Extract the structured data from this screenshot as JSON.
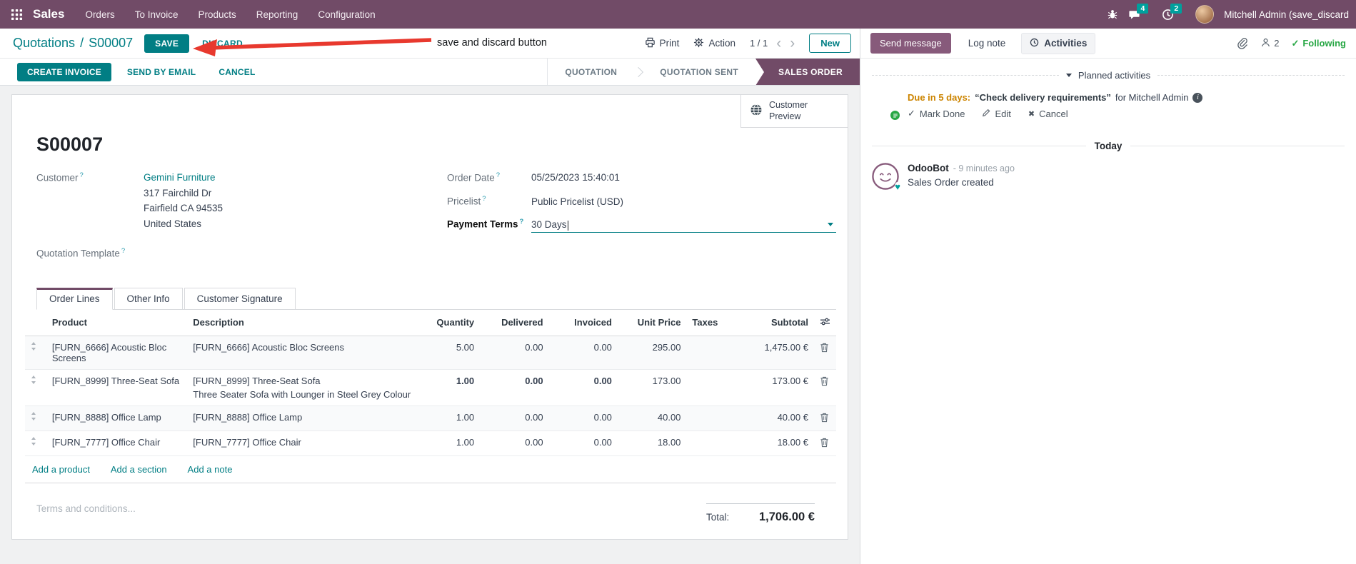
{
  "nav": {
    "app_name": "Sales",
    "menus": [
      "Orders",
      "To Invoice",
      "Products",
      "Reporting",
      "Configuration"
    ],
    "messages_badge": "4",
    "activities_badge": "2",
    "user_name": "Mitchell Admin (save_discard"
  },
  "breadcrumb": {
    "parent": "Quotations",
    "separator": "/",
    "current": "S00007"
  },
  "edit_actions": {
    "save": "SAVE",
    "discard": "DISCARD"
  },
  "annotation": {
    "text": "save and discard button"
  },
  "control_panel": {
    "print": "Print",
    "action": "Action",
    "pager": "1 / 1",
    "new": "New"
  },
  "statusbar": {
    "buttons": [
      "CREATE INVOICE",
      "SEND BY EMAIL",
      "CANCEL"
    ],
    "stages": [
      "QUOTATION",
      "QUOTATION SENT",
      "SALES ORDER"
    ]
  },
  "form": {
    "title": "S00007",
    "help_marker": "?",
    "customer_preview": "Customer Preview",
    "fields": {
      "customer_label": "Customer",
      "customer_name": "Gemini Furniture",
      "customer_address": [
        "317 Fairchild Dr",
        "Fairfield CA 94535",
        "United States"
      ],
      "quotation_template_label": "Quotation Template",
      "order_date_label": "Order Date",
      "order_date_value": "05/25/2023 15:40:01",
      "pricelist_label": "Pricelist",
      "pricelist_value": "Public Pricelist (USD)",
      "payment_terms_label": "Payment Terms",
      "payment_terms_value": "30 Days"
    },
    "tabs": [
      "Order Lines",
      "Other Info",
      "Customer Signature"
    ],
    "lines": {
      "columns": {
        "product": "Product",
        "description": "Description",
        "quantity": "Quantity",
        "delivered": "Delivered",
        "invoiced": "Invoiced",
        "unit_price": "Unit Price",
        "taxes": "Taxes",
        "subtotal": "Subtotal"
      },
      "rows": [
        {
          "product": "[FURN_6666] Acoustic Bloc Screens",
          "desc1": "[FURN_6666] Acoustic Bloc Screens",
          "desc2": "",
          "qty": "5.00",
          "delivered": "0.00",
          "invoiced": "0.00",
          "price": "295.00",
          "taxes": "",
          "subtotal": "1,475.00 €"
        },
        {
          "product": "[FURN_8999] Three-Seat Sofa",
          "desc1": "[FURN_8999] Three-Seat Sofa",
          "desc2": "Three Seater Sofa with Lounger in Steel Grey Colour",
          "qty": "1.00",
          "delivered": "0.00",
          "invoiced": "0.00",
          "price": "173.00",
          "taxes": "",
          "subtotal": "173.00 €"
        },
        {
          "product": "[FURN_8888] Office Lamp",
          "desc1": "[FURN_8888] Office Lamp",
          "desc2": "",
          "qty": "1.00",
          "delivered": "0.00",
          "invoiced": "0.00",
          "price": "40.00",
          "taxes": "",
          "subtotal": "40.00 €"
        },
        {
          "product": "[FURN_7777] Office Chair",
          "desc1": "[FURN_7777] Office Chair",
          "desc2": "",
          "qty": "1.00",
          "delivered": "0.00",
          "invoiced": "0.00",
          "price": "18.00",
          "taxes": "",
          "subtotal": "18.00 €"
        }
      ],
      "footer_links": [
        "Add a product",
        "Add a section",
        "Add a note"
      ]
    },
    "terms_placeholder": "Terms and conditions...",
    "total_label": "Total:",
    "total_value": "1,706.00 €"
  },
  "chatter": {
    "send_message": "Send message",
    "log_note": "Log note",
    "activities": "Activities",
    "followers_count": "2",
    "following": "Following",
    "planned": {
      "title": "Planned activities",
      "due": "Due in 5 days:",
      "summary": "“Check delivery requirements”",
      "assignee": "for Mitchell Admin",
      "mark_done": "Mark Done",
      "edit": "Edit",
      "cancel": "Cancel"
    },
    "today": "Today",
    "message": {
      "author": "OdooBot",
      "time": "- 9 minutes ago",
      "body": "Sales Order created"
    }
  },
  "colors": {
    "brand_purple": "#714B67",
    "chatter_purple": "#875A7B",
    "primary_teal": "#017E84",
    "badge_teal": "#00A09D",
    "annotation_red": "#E8392E",
    "warning_amber": "#CC8400",
    "success_green": "#28A745",
    "modified_blue": "#2E9DD8"
  }
}
